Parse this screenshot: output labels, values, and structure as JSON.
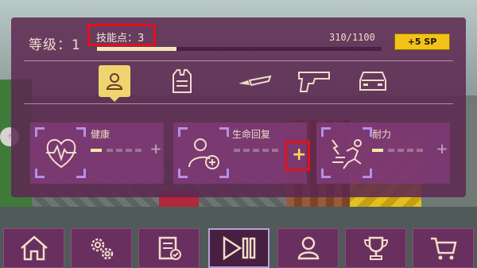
{
  "header": {
    "level_label": "等级：1",
    "skill_points_label": "技能点：3",
    "xp_text": "310/1100",
    "xp_progress": 0.28,
    "buy_sp_label": "+5 SP"
  },
  "categories": [
    {
      "name": "character",
      "icon": "person-icon",
      "active": true
    },
    {
      "name": "armor",
      "icon": "vest-icon",
      "active": false
    },
    {
      "name": "knife",
      "icon": "knife-icon",
      "active": false
    },
    {
      "name": "pistol",
      "icon": "pistol-icon",
      "active": false
    },
    {
      "name": "car",
      "icon": "car-icon",
      "active": false
    }
  ],
  "skills": [
    {
      "name": "健康",
      "icon": "heart-pulse-icon",
      "level": 1,
      "max": 5
    },
    {
      "name": "生命回复",
      "icon": "person-plus-icon",
      "level": 0,
      "max": 5
    },
    {
      "name": "耐力",
      "icon": "runner-icon",
      "level": 1,
      "max": 5
    }
  ],
  "side_button_label": "?",
  "nav": [
    {
      "icon": "home-icon"
    },
    {
      "icon": "gears-icon"
    },
    {
      "icon": "checklist-icon"
    },
    {
      "icon": "play-pause-icon"
    },
    {
      "icon": "person-icon"
    },
    {
      "icon": "trophy-icon"
    },
    {
      "icon": "cart-icon"
    }
  ],
  "colors": {
    "panel": "#5c2850",
    "accent_yellow": "#f2c21a",
    "highlight_red": "#e3101b",
    "text": "#f1dcc9"
  }
}
